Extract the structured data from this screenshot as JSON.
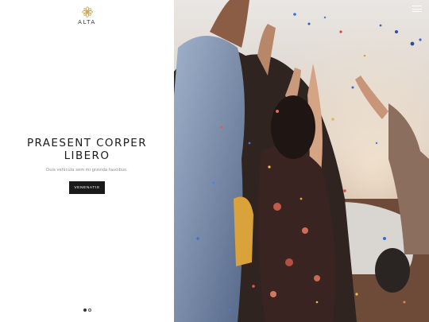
{
  "brand": {
    "logo_text": "ALTA",
    "logo_color": "#c9973b"
  },
  "hero": {
    "title": "PRAESENT CORPER LIBERO",
    "subtitle": "Duis vehicula sem mi gravida faucibus.",
    "button_label": "VENENATIS"
  },
  "slider": {
    "current_slide": 1,
    "total_slides": 2
  },
  "menu": {
    "icon": "hamburger-menu-icon"
  },
  "photo": {
    "subject": "crowd-celebrating-with-confetti-image"
  },
  "colors": {
    "button_bg": "#1a1a1a",
    "title": "#1c1c1c",
    "subtitle": "#8a8a8a"
  }
}
